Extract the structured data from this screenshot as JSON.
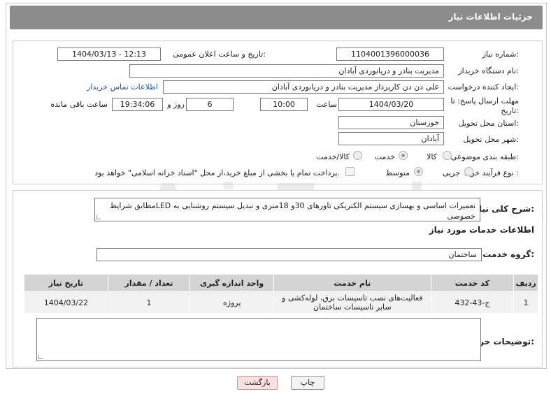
{
  "header": {
    "title": "جزئیات اطلاعات نیاز"
  },
  "form": {
    "need_number": {
      "label": "شماره نیاز:",
      "value": "1104001396000036"
    },
    "announce_datetime": {
      "label": "تاریخ و ساعت اعلان عمومی:",
      "value": "1404/03/13 - 12:13"
    },
    "buyer_org": {
      "label": "نام دستگاه خریدار:",
      "value": "مدیریت بنادر و دریانوردی آبادان"
    },
    "creator": {
      "label": "ایجاد کننده درخواست:",
      "value": "علی دن دن کارپرداز  مدیریت بنادر و دریانوردی آبادان"
    },
    "contact_link": "اطلاعات تماس خریدار",
    "deadline": {
      "label_line1": "مهلت ارسال پاسخ: تا",
      "label_line2": "تاریخ:",
      "date": "1404/03/20",
      "time_label": "ساعت",
      "time": "10:00",
      "days": "6",
      "days_label": "روز و",
      "remaining": "19:34:06",
      "remaining_label": "ساعت باقی مانده"
    },
    "province": {
      "label": "استان محل تحویل:",
      "value": "خوزستان"
    },
    "city": {
      "label": "شهر محل تحویل:",
      "value": "آبادان"
    },
    "category": {
      "label": "طبقه بندی موضوعی:",
      "options": [
        "کالا",
        "خدمت",
        "کالا/خدمت"
      ],
      "selected": "خدمت"
    },
    "process": {
      "label": "نوع فرآیند خرید :",
      "options": [
        "جزیی",
        "متوسط"
      ],
      "selected": "متوسط",
      "payment_note": "پرداخت تمام یا بخشی از مبلغ خرید،از محل \"اسناد خزانه اسلامی\" خواهد بود."
    }
  },
  "summary": {
    "label": "شرح کلی نیاز:",
    "text": "تعمیرات اساسی و بهسازی سیستم الکتریکی تاورهای 30و 18متری و تبدیل سیستم روشنایی به LEDمطابق شرایط خصوصی"
  },
  "services": {
    "section_title": "اطلاعات خدمات مورد نیاز",
    "group_label": "گروه خدمت:",
    "group_value": "ساختمان",
    "columns": [
      "ردیف",
      "کد خدمت",
      "نام خدمت",
      "واحد اندازه گیری",
      "تعداد / مقدار",
      "تاریخ نیاز"
    ],
    "rows": [
      {
        "row": "1",
        "code": "ج-43-432",
        "name": "فعالیت‌های نصب تاسیسات برق، لوله‌کشی و سایر تاسیسات ساختمان",
        "unit": "پروژه",
        "qty": "1",
        "date": "1404/03/22"
      }
    ]
  },
  "buyer_notes": {
    "label": "توضیحات خریدار:",
    "value": ""
  },
  "buttons": {
    "print": "چاپ",
    "back": "بازگشت"
  },
  "watermark": "AriaTender.net",
  "colors": {
    "header_bg": "#8c8c8c",
    "link": "#1a55b5",
    "back_button_bg": "#fde0e0"
  }
}
